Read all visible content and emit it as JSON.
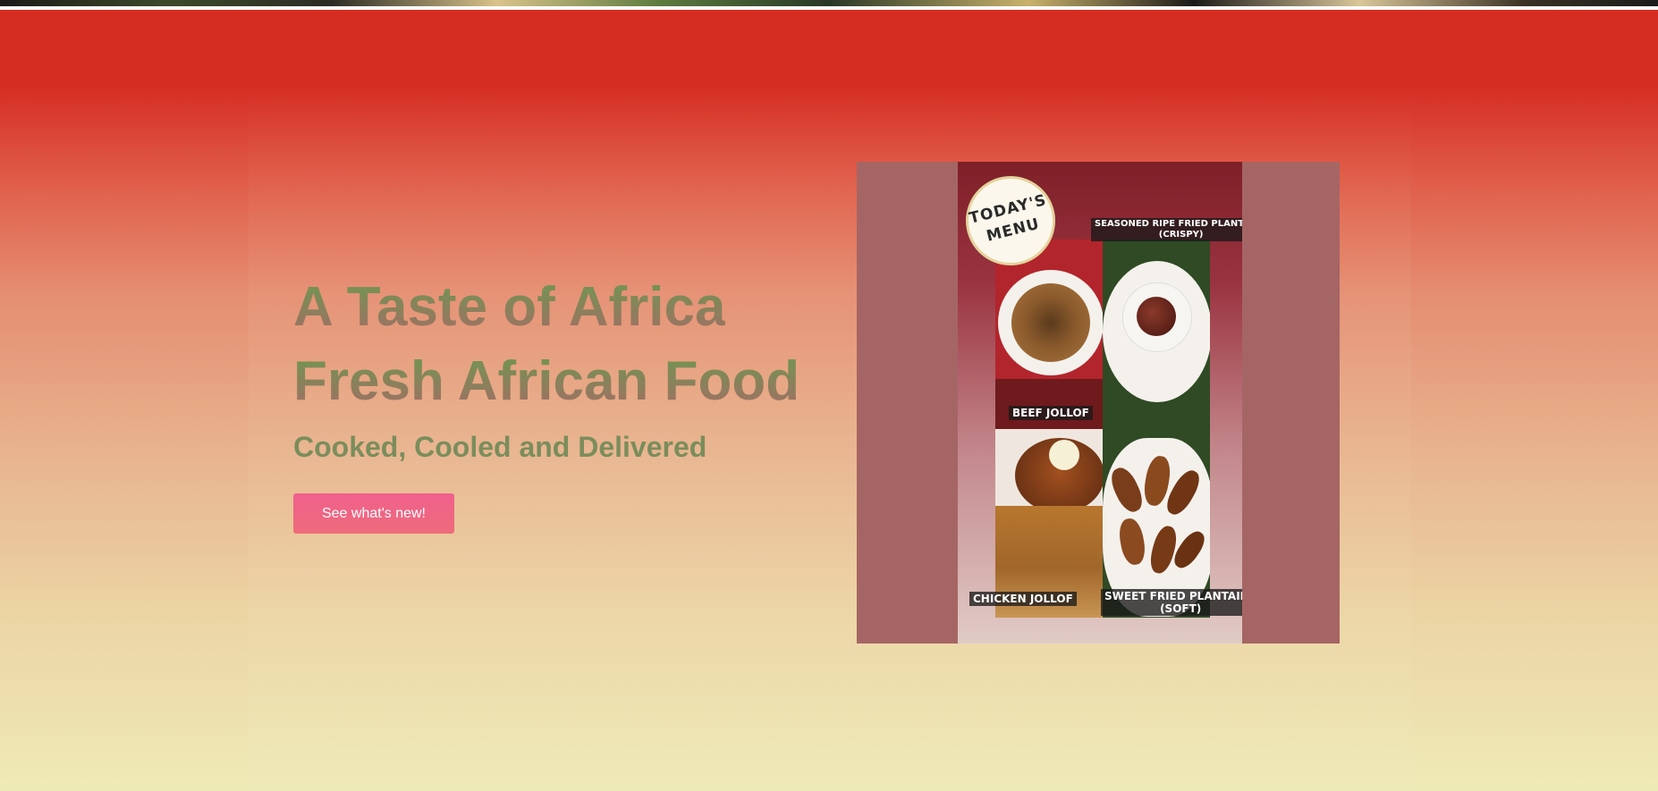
{
  "hero": {
    "title_line1": "A Taste of Africa",
    "title_line2": "Fresh African Food",
    "subtitle": "Cooked, Cooled and Delivered",
    "cta_label": "See what's new!"
  },
  "menu_image": {
    "badge_text_line1": "TODAY'S",
    "badge_text_line2": "MENU",
    "items": [
      {
        "label": "BEEF JOLLOF"
      },
      {
        "label_line1": "SEASONED RIPE FRIED PLANTAINS",
        "label_line2": "(CRISPY)"
      },
      {
        "label": "CHICKEN JOLLOF"
      },
      {
        "label_line1": "SWEET FRIED PLANTAINS",
        "label_line2": "(SOFT)"
      }
    ]
  },
  "colors": {
    "background_top": "#d62d23",
    "background_bottom": "#eeeab6",
    "title_gradient_top": "#6b9a4f",
    "title_gradient_bottom": "#a56b67",
    "subtitle": "#7b8d5c",
    "button": "#f0608e",
    "image_frame": "#a66565"
  }
}
